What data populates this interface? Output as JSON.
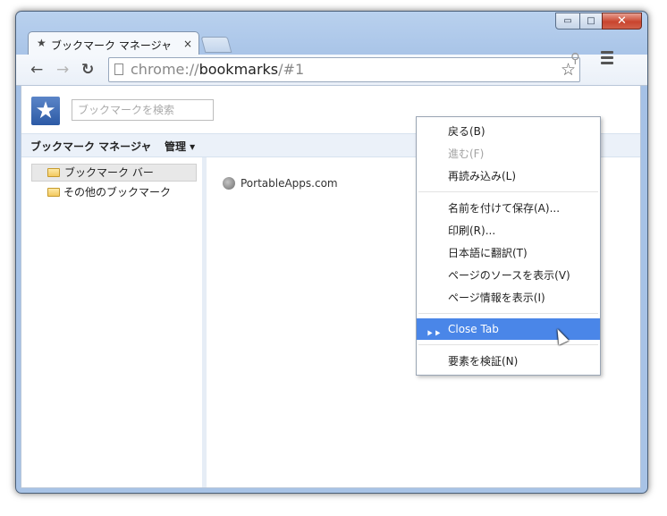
{
  "window": {
    "controls": {
      "minimize": "▭",
      "maximize": "□",
      "close": "✕"
    }
  },
  "tab": {
    "title": "ブックマーク マネージャ",
    "icon": "star-icon",
    "close": "×"
  },
  "toolbar": {
    "back": "←",
    "forward": "→",
    "reload": "↻",
    "url_scheme": "chrome://",
    "url_host": "bookmarks",
    "url_rest": "/#1",
    "bookmark_star": "☆",
    "search_icon": "🔍"
  },
  "page": {
    "logo": "★",
    "search_placeholder": "ブックマークを検索",
    "header_title": "ブックマーク マネージャ",
    "organize_label": "管理 ▾",
    "folders": [
      {
        "label": "ブックマーク バー",
        "selected": true
      },
      {
        "label": "その他のブックマーク",
        "selected": false
      }
    ],
    "bookmarks": [
      {
        "label": "PortableApps.com",
        "icon": "globe-icon"
      }
    ]
  },
  "context_menu": {
    "items": [
      {
        "label": "戻る(B)",
        "state": "normal"
      },
      {
        "label": "進む(F)",
        "state": "disabled"
      },
      {
        "label": "再読み込み(L)",
        "state": "normal"
      },
      {
        "label": "名前を付けて保存(A)...",
        "state": "normal"
      },
      {
        "label": "印刷(R)...",
        "state": "normal"
      },
      {
        "label": "日本語に翻訳(T)",
        "state": "normal"
      },
      {
        "label": "ページのソースを表示(V)",
        "state": "normal"
      },
      {
        "label": "ページ情報を表示(I)",
        "state": "normal"
      },
      {
        "label": "Close Tab",
        "state": "highlighted"
      },
      {
        "label": "要素を検証(N)",
        "state": "normal"
      }
    ],
    "highlight_color": "#4a86e8"
  }
}
